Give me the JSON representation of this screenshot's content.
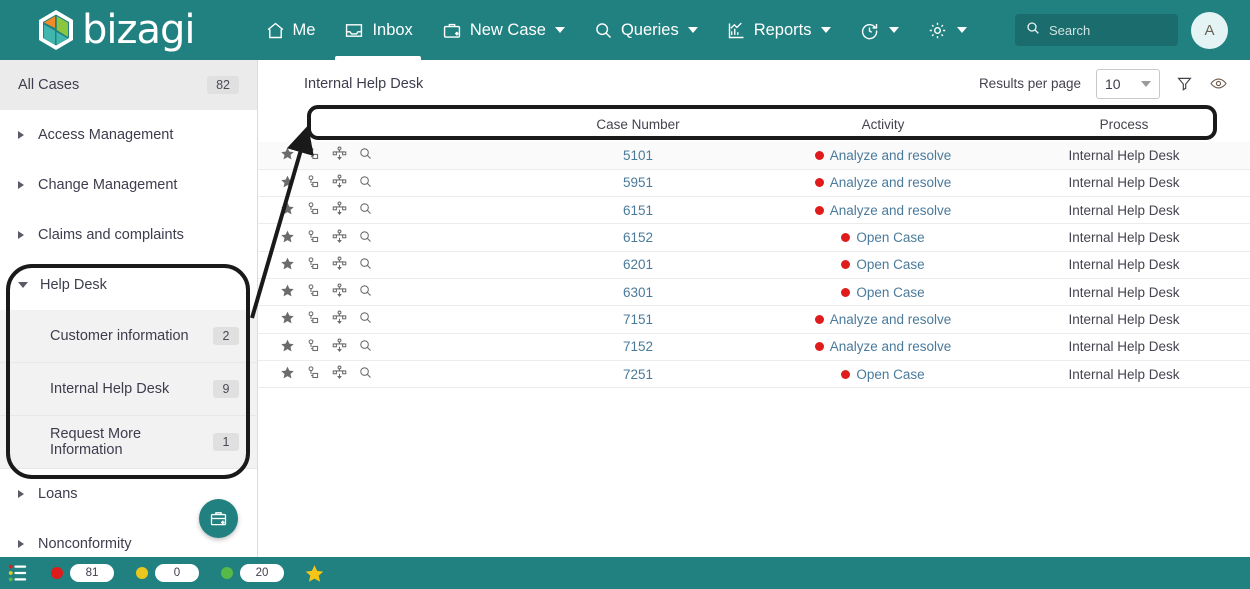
{
  "brand": {
    "name": "bizagi",
    "teal": "#218080",
    "logo_icon": "bizagi-hexagon-logo"
  },
  "topnav": {
    "items": [
      {
        "label": "Me",
        "icon": "home-icon",
        "has_caret": false,
        "active": false
      },
      {
        "label": "Inbox",
        "icon": "inbox-icon",
        "has_caret": false,
        "active": true
      },
      {
        "label": "New Case",
        "icon": "briefcase-plus-icon",
        "has_caret": true,
        "active": false
      },
      {
        "label": "Queries",
        "icon": "search-icon",
        "has_caret": true,
        "active": false
      },
      {
        "label": "Reports",
        "icon": "chart-icon",
        "has_caret": true,
        "active": false
      },
      {
        "label": "",
        "icon": "refresh-clock-icon",
        "has_caret": true,
        "active": false
      },
      {
        "label": "",
        "icon": "gear-icon",
        "has_caret": true,
        "active": false
      }
    ],
    "search": {
      "placeholder": "Search",
      "icon": "search-icon",
      "value": ""
    },
    "avatar": {
      "initial": "A"
    }
  },
  "sidebar": {
    "all_cases": {
      "label": "All Cases",
      "count": "82"
    },
    "groups": [
      {
        "label": "Access Management",
        "expanded": false
      },
      {
        "label": "Change Management",
        "expanded": false
      },
      {
        "label": "Claims and complaints",
        "expanded": false
      },
      {
        "label": "Help Desk",
        "expanded": true
      },
      {
        "label": "Loans",
        "expanded": false
      },
      {
        "label": "Nonconformity",
        "expanded": false
      }
    ],
    "help_desk_children": [
      {
        "label": "Customer information",
        "count": "2"
      },
      {
        "label": "Internal Help Desk",
        "count": "9"
      },
      {
        "label": "Request More Information",
        "count": "1"
      }
    ],
    "fab": {
      "icon": "new-case-briefcase-plus-icon"
    }
  },
  "content": {
    "title": "Internal Help Desk",
    "results_per_page_label": "Results per page",
    "results_per_page_value": "10",
    "filter_icon": "funnel-filter-icon",
    "view_icon": "eye-visibility-icon",
    "columns": [
      "",
      "Case Number",
      "Activity",
      "Process"
    ],
    "row_action_icons": [
      "star-icon",
      "assign-user-icon",
      "workflow-diagram-icon",
      "magnifier-search-icon"
    ],
    "rows": [
      {
        "case_number": "5101",
        "activity": "Analyze and resolve",
        "status_color": "#e01b1b",
        "process": "Internal Help Desk"
      },
      {
        "case_number": "5951",
        "activity": "Analyze and resolve",
        "status_color": "#e01b1b",
        "process": "Internal Help Desk"
      },
      {
        "case_number": "6151",
        "activity": "Analyze and resolve",
        "status_color": "#e01b1b",
        "process": "Internal Help Desk"
      },
      {
        "case_number": "6152",
        "activity": "Open Case",
        "status_color": "#e01b1b",
        "process": "Internal Help Desk"
      },
      {
        "case_number": "6201",
        "activity": "Open Case",
        "status_color": "#e01b1b",
        "process": "Internal Help Desk"
      },
      {
        "case_number": "6301",
        "activity": "Open Case",
        "status_color": "#e01b1b",
        "process": "Internal Help Desk"
      },
      {
        "case_number": "7151",
        "activity": "Analyze and resolve",
        "status_color": "#e01b1b",
        "process": "Internal Help Desk"
      },
      {
        "case_number": "7152",
        "activity": "Analyze and resolve",
        "status_color": "#e01b1b",
        "process": "Internal Help Desk"
      },
      {
        "case_number": "7251",
        "activity": "Open Case",
        "status_color": "#e01b1b",
        "process": "Internal Help Desk"
      }
    ]
  },
  "bottombar": {
    "menu_icon": "list-menu-icon",
    "counters": [
      {
        "color": "#e01b1b",
        "value": "81"
      },
      {
        "color": "#e8c81e",
        "value": "0"
      },
      {
        "color": "#57b947",
        "value": "20"
      }
    ],
    "star_icon": "favorite-star-icon",
    "star_color": "#f5c518"
  }
}
